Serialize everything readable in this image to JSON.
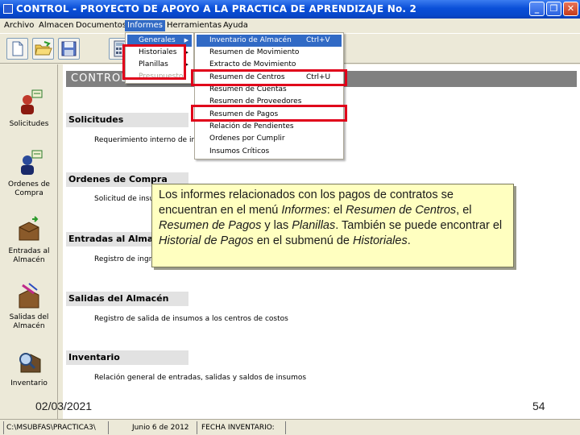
{
  "window": {
    "title": "CONTROL - PROYECTO DE APOYO A LA PRACTICA DE APRENDIZAJE No. 2"
  },
  "menubar": {
    "items": [
      "Archivo",
      "Almacen",
      "Documentos",
      "Informes",
      "Herramientas",
      "Ayuda"
    ]
  },
  "toolbar": {
    "buttons": [
      "new-document",
      "open-folder",
      "save-disk",
      "calculator"
    ]
  },
  "informes_menu": {
    "items": [
      {
        "label": "Generales",
        "submenu": true
      },
      {
        "label": "Historiales",
        "submenu": true
      },
      {
        "label": "Planillas",
        "submenu": true
      },
      {
        "label": "Presupuesto",
        "submenu": false,
        "disabled": true
      }
    ]
  },
  "generales_submenu": {
    "items": [
      {
        "label": "Inventario de Almacén",
        "shortcut": "Ctrl+V"
      },
      {
        "label": "Resumen de Movimiento",
        "shortcut": ""
      },
      {
        "label": "Extracto de Movimiento",
        "shortcut": ""
      },
      {
        "label": "Resumen de Centros",
        "shortcut": "Ctrl+U"
      },
      {
        "label": "Resumen de Cuentas",
        "shortcut": ""
      },
      {
        "label": "Resumen de Proveedores",
        "shortcut": ""
      },
      {
        "label": "Resumen de Pagos",
        "shortcut": ""
      },
      {
        "label": "Relación de Pendientes",
        "shortcut": ""
      },
      {
        "label": "Ordenes por Cumplir",
        "shortcut": ""
      },
      {
        "label": "Insumos Críticos",
        "shortcut": ""
      }
    ]
  },
  "leftnav": {
    "items": [
      {
        "label": "Solicitudes"
      },
      {
        "label": "Ordenes de Compra"
      },
      {
        "label": "Entradas al Almacén"
      },
      {
        "label": "Salidas del Almacén"
      },
      {
        "label": "Inventario"
      }
    ]
  },
  "content": {
    "header": "CONTROL -",
    "sections": [
      {
        "title": "Solicitudes",
        "desc": "Requerimiento interno de insu"
      },
      {
        "title": "Ordenes de Compra",
        "desc": "Solicitud de insu"
      },
      {
        "title": "Entradas al Almacén",
        "desc": "Registro de ingre"
      },
      {
        "title": "Salidas del Almacén",
        "desc": "Registro de salida de insumos a los centros de costos"
      },
      {
        "title": "Inventario",
        "desc": "Relación general de entradas, salidas y saldos de insumos"
      }
    ]
  },
  "callout": {
    "parts": [
      "Los informes relacionados con los pagos de contratos se encuentran en el menú ",
      "Informes",
      ": el ",
      "Resumen de Centros",
      ", el ",
      "Resumen de Pagos",
      " y las ",
      "Planillas",
      ". También se puede encontrar el ",
      "Historial de Pagos",
      " en el submenú de ",
      "Historiales",
      "."
    ]
  },
  "statusbar": {
    "path": "C:\\MSUBFAS\\PRACTICA3\\",
    "date": "Junio 6 de 2012",
    "field": "FECHA INVENTARIO: "
  },
  "slide": {
    "date": "02/03/2021",
    "page": "54"
  },
  "colors": {
    "titlebar": "#0a4fd8",
    "menu_highlight": "#316ac5",
    "callout_bg": "#ffffc0",
    "annotation_box": "#e0001a"
  }
}
